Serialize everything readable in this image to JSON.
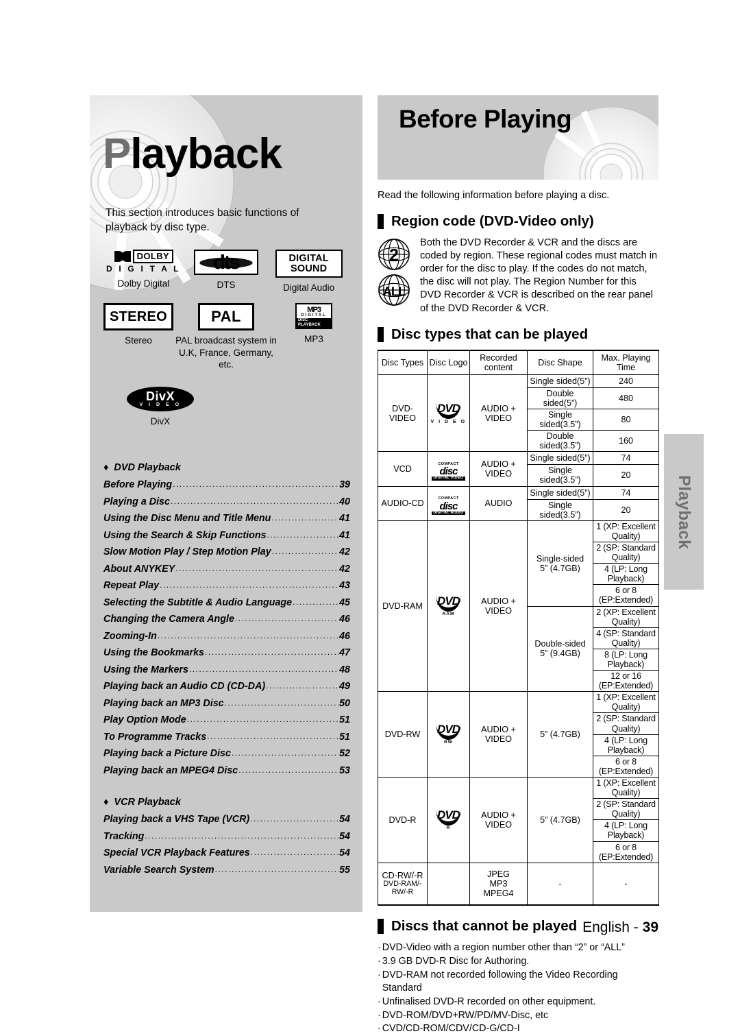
{
  "left_panel": {
    "chapter_title_cap": "P",
    "chapter_title_rest": "layback",
    "intro_text": "This section introduces basic functions of playback by disc type.",
    "logos": [
      {
        "id": "dolby-digital",
        "caption": "Dolby Digital",
        "text_top": "DOLBY",
        "text_bottom": "D I G I T A L"
      },
      {
        "id": "dts",
        "caption": "DTS",
        "text": "dts"
      },
      {
        "id": "digital-sound",
        "caption": "Digital Audio",
        "line1": "DIGITAL",
        "line2": "SOUND"
      },
      {
        "id": "stereo",
        "caption": "Stereo",
        "text": "STEREO"
      },
      {
        "id": "pal",
        "caption": "PAL broadcast system in U.K, France, Germany, etc.",
        "text": "PAL"
      },
      {
        "id": "mp3",
        "caption": "MP3",
        "text": "MP3",
        "sub1": "DIGITAL",
        "sub2": "DISC PLAYBACK"
      },
      {
        "id": "divx",
        "caption": "DivX",
        "text": "DivX",
        "sub": "V I D E O"
      }
    ]
  },
  "toc": {
    "groups": [
      {
        "title": "DVD Playback",
        "diamond": "♦",
        "items": [
          {
            "label": "Before Playing",
            "page": "39"
          },
          {
            "label": "Playing a Disc",
            "page": "40"
          },
          {
            "label": "Using the Disc Menu and Title Menu",
            "page": "41"
          },
          {
            "label": "Using the Search & Skip Functions",
            "page": "41"
          },
          {
            "label": "Slow Motion Play / Step Motion Play",
            "page": "42"
          },
          {
            "label": "About ANYKEY",
            "page": "42"
          },
          {
            "label": "Repeat Play",
            "page": "43"
          },
          {
            "label": "Selecting the Subtitle & Audio Language",
            "page": "45"
          },
          {
            "label": "Changing the Camera Angle",
            "page": "46"
          },
          {
            "label": "Zooming-In",
            "page": "46"
          },
          {
            "label": "Using the Bookmarks",
            "page": "47"
          },
          {
            "label": "Using the Markers",
            "page": "48"
          },
          {
            "label": "Playing back an Audio CD (CD-DA)",
            "page": "49"
          },
          {
            "label": "Playing back an MP3 Disc",
            "page": "50"
          },
          {
            "label": "Play Option Mode",
            "page": "51"
          },
          {
            "label": "To Programme Tracks",
            "page": "51"
          },
          {
            "label": "Playing back a Picture Disc",
            "page": "52"
          },
          {
            "label": "Playing back an MPEG4 Disc",
            "page": "53"
          }
        ]
      },
      {
        "title": "VCR Playback",
        "diamond": "♦",
        "items": [
          {
            "label": "Playing back a VHS Tape (VCR)",
            "page": "54"
          },
          {
            "label": "Tracking",
            "page": "54"
          },
          {
            "label": "Special VCR Playback Features",
            "page": "54"
          },
          {
            "label": "Variable Search System",
            "page": "55"
          }
        ]
      }
    ]
  },
  "right": {
    "banner_title": "Before Playing",
    "lead_text": "Read the following information before playing a disc.",
    "region_section": {
      "heading": "Region code (DVD-Video only)",
      "icon_2": "2",
      "icon_all": "ALL",
      "body": "Both the DVD Recorder & VCR and the discs are coded by region. These regional codes must match in order for the disc to play. If the codes do not match, the disc will not play. The Region Number for this DVD Recorder & VCR is described on the rear panel of the DVD Recorder & VCR."
    },
    "disc_types_section": {
      "heading": "Disc types that can be played",
      "columns": [
        "Disc Types",
        "Disc Logo",
        "Recorded content",
        "Disc Shape",
        "Max. Playing Time"
      ],
      "rows": [
        {
          "disc_type": "DVD-VIDEO",
          "logo": "DVD",
          "logo_sub": "V I D E O",
          "content": "AUDIO + VIDEO",
          "shapes": [
            {
              "shape": "Single sided(5”)",
              "time": "240"
            },
            {
              "shape": "Double sided(5”)",
              "time": "480"
            },
            {
              "shape": "Single sided(3.5”)",
              "time": "80"
            },
            {
              "shape": "Double sided(3.5”)",
              "time": "160"
            }
          ]
        },
        {
          "disc_type": "VCD",
          "logo": "disc",
          "logo_top": "COMPACT",
          "logo_sub": "DIGITAL VIDEO",
          "content": "AUDIO + VIDEO",
          "shapes": [
            {
              "shape": "Single sided(5”)",
              "time": "74"
            },
            {
              "shape": "Single sided(3.5”)",
              "time": "20"
            }
          ]
        },
        {
          "disc_type": "AUDIO-CD",
          "logo": "disc",
          "logo_top": "COMPACT",
          "logo_sub": "DIGITAL AUDIO",
          "content": "AUDIO",
          "shapes": [
            {
              "shape": "Single sided(5”)",
              "time": "74"
            },
            {
              "shape": "Single sided(3.5”)",
              "time": "20"
            }
          ]
        },
        {
          "disc_type": "DVD-RAM",
          "logo": "DVD",
          "logo_sub": "RAM",
          "content": "AUDIO + VIDEO",
          "shapes": [
            {
              "shape": "Single-sided 5” (4.7GB)",
              "shape_l1": "Single-sided",
              "shape_l2": "5” (4.7GB)",
              "times": [
                "1 (XP: Excellent Quality)",
                "2 (SP: Standard Quality)",
                "4 (LP: Long Playback)",
                "6 or 8 (EP:Extended)"
              ]
            },
            {
              "shape": "Double-sided 5” (9.4GB)",
              "shape_l1": "Double-sided",
              "shape_l2": "5” (9.4GB)",
              "times": [
                "2 (XP: Excellent Quality)",
                "4 (SP: Standard Quality)",
                "8 (LP: Long Playback)",
                "12 or 16 (EP:Extended)"
              ]
            }
          ]
        },
        {
          "disc_type": "DVD-RW",
          "logo": "DVD",
          "logo_sub": "RW",
          "content": "AUDIO + VIDEO",
          "shapes": [
            {
              "shape": "5” (4.7GB)",
              "times": [
                "1 (XP: Excellent Quality)",
                "2 (SP: Standard Quality)",
                "4 (LP: Long Playback)",
                "6 or 8 (EP:Extended)"
              ]
            }
          ]
        },
        {
          "disc_type": "DVD-R",
          "logo": "DVD",
          "logo_sub": "R",
          "content": "AUDIO + VIDEO",
          "shapes": [
            {
              "shape": "5” (4.7GB)",
              "times": [
                "1 (XP: Excellent Quality)",
                "2 (SP: Standard Quality)",
                "4 (LP: Long Playback)",
                "6 or 8 (EP:Extended)"
              ]
            }
          ]
        },
        {
          "disc_type_l1": "CD-RW/-R",
          "disc_type_l2": "DVD-RAM/-RW/-R",
          "logo": "",
          "content_l1": "JPEG",
          "content_l2": "MP3",
          "content_l3": "MPEG4",
          "shape": "-",
          "time": "-"
        }
      ]
    },
    "cannot_play_section": {
      "heading": "Discs that cannot be played",
      "items": [
        "DVD-Video with a region number other than “2” or “ALL”",
        "3.9 GB DVD-R Disc for Authoring.",
        "DVD-RAM not recorded following the Video Recording Standard",
        "Unfinalised DVD-R recorded on other equipment.",
        "DVD-ROM/DVD+RW/PD/MV-Disc, etc",
        "CVD/CD-ROM/CDV/CD-G/CD-I"
      ],
      "bullet": "·"
    }
  },
  "side_tab": {
    "label": "Playback"
  },
  "footer": {
    "language": "English - ",
    "page": "39"
  }
}
